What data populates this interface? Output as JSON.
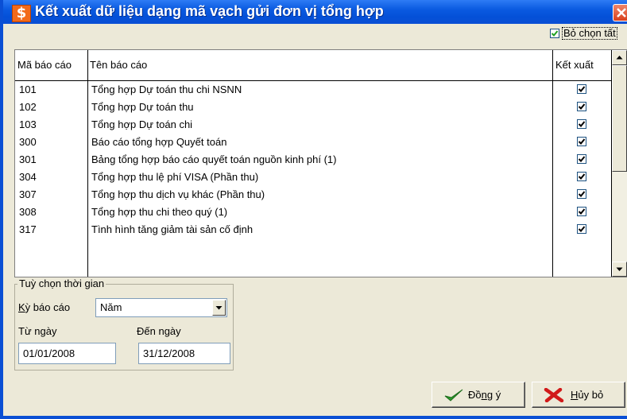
{
  "window": {
    "title": "Kết xuất dữ liệu dạng mã vạch gửi đơn vị tổng hợp",
    "app_icon": "$"
  },
  "select_all": {
    "label": "Bỏ chọn tất",
    "checked": true
  },
  "table": {
    "columns": {
      "code": "Mã báo cáo",
      "name": "Tên báo cáo",
      "export": "Kết xuất"
    },
    "rows": [
      {
        "code": "101",
        "name": "Tổng hợp Dự toán thu chi NSNN",
        "export": true
      },
      {
        "code": "102",
        "name": "Tổng hợp Dự toán thu",
        "export": true
      },
      {
        "code": "103",
        "name": "Tổng hợp Dự toán chi",
        "export": true
      },
      {
        "code": "300",
        "name": "Báo cáo tổng hợp Quyết toán",
        "export": true
      },
      {
        "code": "301",
        "name": "Bảng tổng hợp báo cáo quyết toán nguồn kinh phí (1)",
        "export": true
      },
      {
        "code": "304",
        "name": "Tổng hợp thu lệ phí VISA (Phần thu)",
        "export": true
      },
      {
        "code": "307",
        "name": "Tổng hợp thu dịch vụ khác (Phần thu)",
        "export": true
      },
      {
        "code": "308",
        "name": "Tổng hợp thu chi theo quý (1)",
        "export": true
      },
      {
        "code": "317",
        "name": "Tình hình tăng giảm tài sản cố định",
        "export": true
      }
    ]
  },
  "time_options": {
    "group_title": "Tuỳ chọn thời gian",
    "period_label_hotkey": "K",
    "period_label_rest": "ỳ báo cáo",
    "period_value": "Năm",
    "from_label": "Từ ngày",
    "from_value": "01/01/2008",
    "to_label": "Đến ngày",
    "to_value": "31/12/2008"
  },
  "buttons": {
    "ok_pre": "Đồ",
    "ok_hotkey": "n",
    "ok_post": "g ý",
    "cancel_hotkey": "H",
    "cancel_post": "ủy bỏ"
  },
  "colors": {
    "titlebar": "#0a5ae0",
    "dialog_bg": "#ece9d8",
    "app_icon": "#f26a1b",
    "close": "#d9401d"
  }
}
